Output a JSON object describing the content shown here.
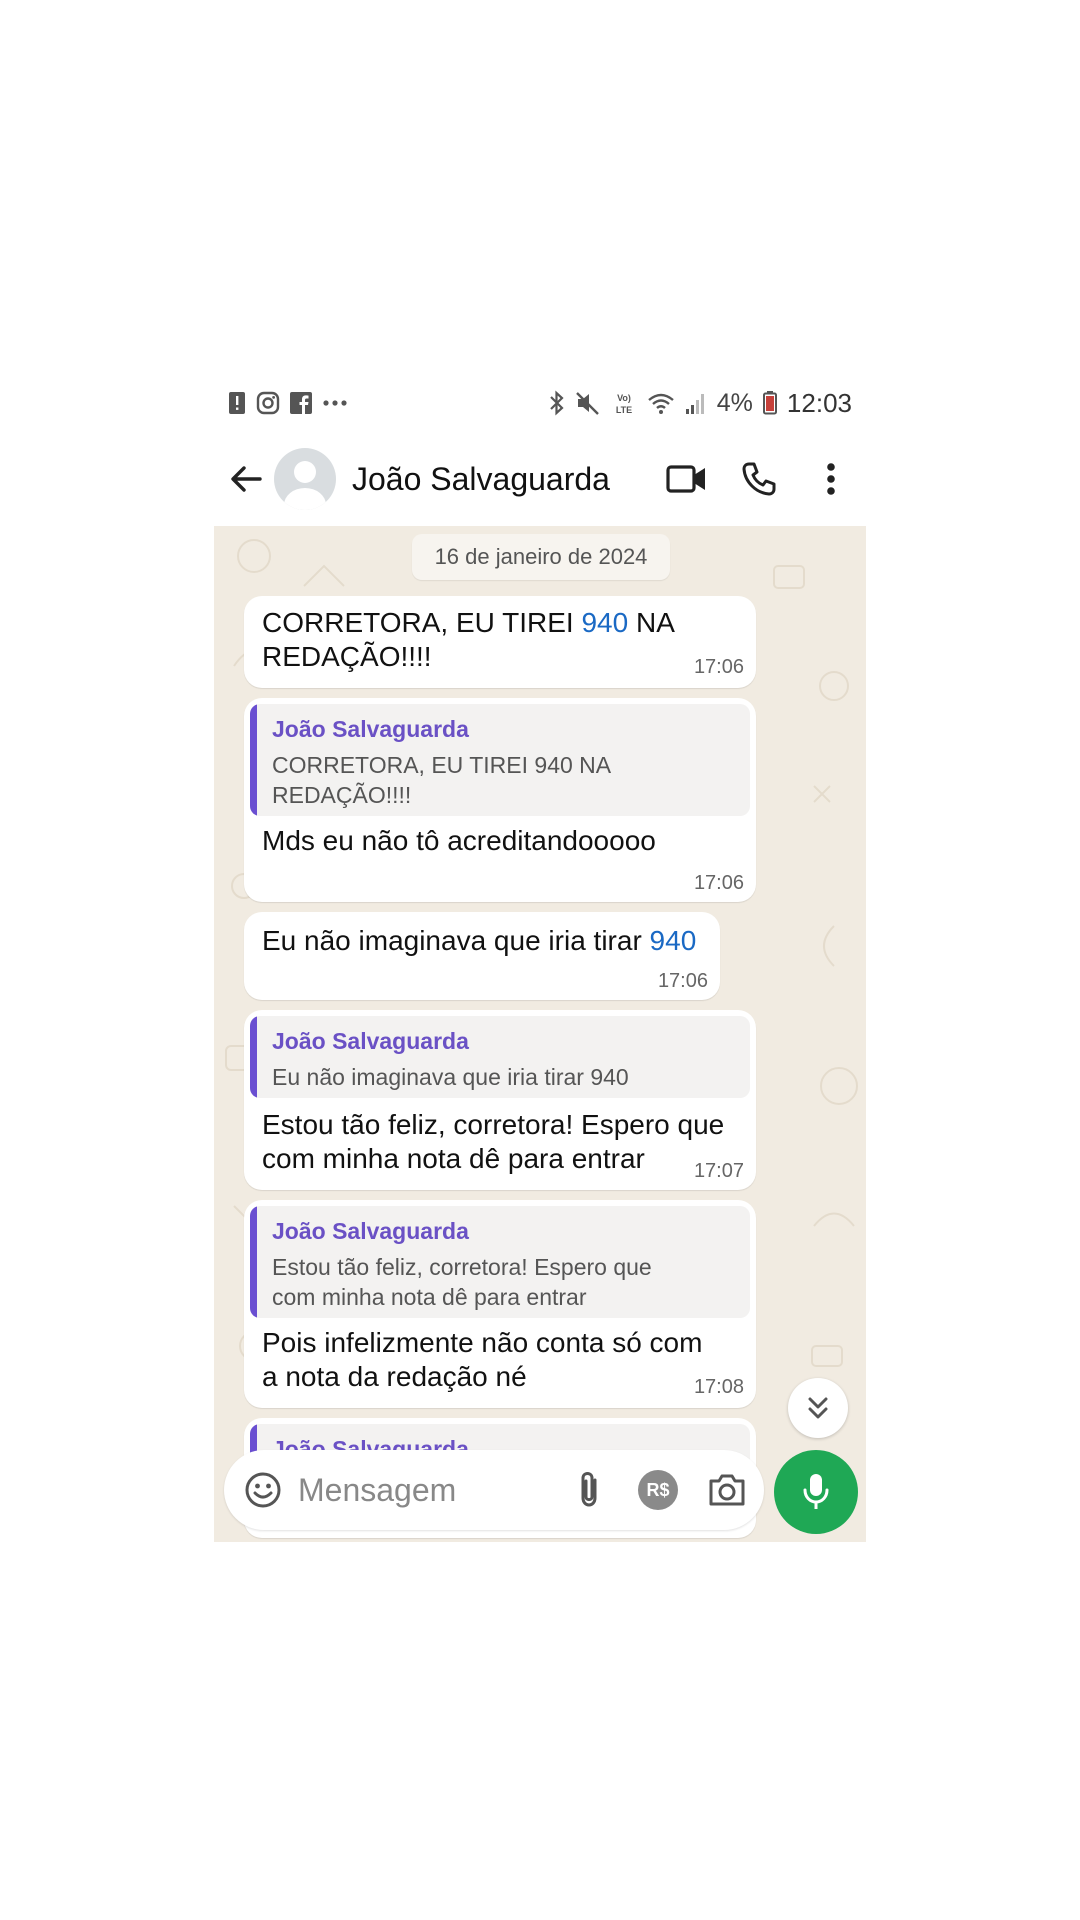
{
  "status_bar": {
    "battery_percent": "4%",
    "time": "12:03",
    "left_icons": [
      "alert-icon",
      "instagram-icon",
      "facebook-icon",
      "more-notifications-icon"
    ],
    "right_icons": [
      "bluetooth-icon",
      "mute-icon",
      "volte-icon",
      "wifi-icon",
      "signal-icon",
      "battery-low-icon"
    ]
  },
  "header": {
    "contact_name": "João Salvaguarda",
    "icons": [
      "back-arrow-icon",
      "avatar",
      "video-call-icon",
      "phone-call-icon",
      "more-vert-icon"
    ]
  },
  "chat": {
    "date": "16 de janeiro de 2024",
    "messages": [
      {
        "line1_pre": "CORRETORA, EU TIREI ",
        "line1_num": "940",
        "line1_post": " NA",
        "line2": "REDAÇÃO!!!!",
        "time": "17:06"
      },
      {
        "quote_name": "João Salvaguarda",
        "quote_line1": "CORRETORA, EU TIREI 940 NA",
        "quote_line2": "REDAÇÃO!!!!",
        "text": "Mds eu não tô acreditandooooo",
        "time": "17:06"
      },
      {
        "text_pre": "Eu não imaginava que iria tirar ",
        "text_num": "940",
        "time": "17:06"
      },
      {
        "quote_name": "João Salvaguarda",
        "quote_line1": "Eu não imaginava que iria tirar 940",
        "line1": "Estou tão feliz, corretora! Espero que",
        "line2": "com minha nota dê para entrar",
        "time": "17:07"
      },
      {
        "quote_name": "João Salvaguarda",
        "quote_line1": "Estou tão feliz, corretora! Espero que",
        "quote_line2": "com minha nota dê para entrar",
        "line1": "Pois infelizmente não conta só com",
        "line2": "a nota da redação né",
        "time": "17:08"
      },
      {
        "quote_name": "João Salvaguarda"
      }
    ]
  },
  "composer": {
    "placeholder": "Mensagem",
    "pay_label": "R$"
  },
  "colors": {
    "accent_green": "#1fa855",
    "quote_bar": "#6a4fd1",
    "quote_name": "#6a51c5",
    "link_number": "#1a69c4",
    "chat_background": "#f1ebe1"
  }
}
